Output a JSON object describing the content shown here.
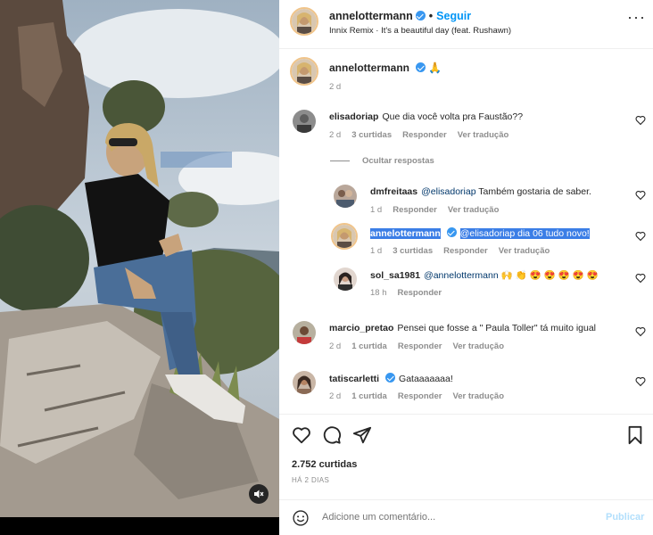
{
  "header": {
    "username": "annelottermann",
    "separator": "•",
    "follow_label": "Seguir",
    "song": "Innix Remix · It's a beautiful day (feat. Rushawn)",
    "more_label": "···"
  },
  "caption": {
    "username": "annelottermann",
    "emoji": "🙏",
    "time": "2 d"
  },
  "comments": [
    {
      "username": "elisadoriap",
      "text": "Que dia você volta pra Faustão??",
      "time": "2 d",
      "likes": "3 curtidas",
      "reply": "Responder",
      "translate": "Ver tradução",
      "hide_replies": "Ocultar respostas"
    }
  ],
  "replies": [
    {
      "username": "dmfreitaas",
      "mention": "@elisadoriap",
      "text": " Também gostaria de saber.",
      "time": "1 d",
      "reply": "Responder",
      "translate": "Ver tradução"
    },
    {
      "username": "annelottermann",
      "mention": "@elisadoriap",
      "text": " dia 06 tudo novo!",
      "time": "1 d",
      "likes": "3 curtidas",
      "reply": "Responder",
      "translate": "Ver tradução"
    },
    {
      "username": "sol_sa1981",
      "mention": "@annelottermann",
      "text": " 🙌 👏 😍 😍 😍 😍 😍",
      "time": "18 h",
      "reply": "Responder"
    }
  ],
  "more_comments": [
    {
      "username": "marcio_pretao",
      "text": "Pensei que fosse a \" Paula Toller\" tá muito igual",
      "time": "2 d",
      "likes": "1 curtida",
      "reply": "Responder",
      "translate": "Ver tradução"
    },
    {
      "username": "tatiscarletti",
      "text": "Gataaaaaaa!",
      "time": "2 d",
      "likes": "1 curtida",
      "reply": "Responder",
      "translate": "Ver tradução"
    }
  ],
  "stats": {
    "likes": "2.752 curtidas",
    "posted": "HÁ 2 DIAS"
  },
  "add_comment": {
    "placeholder": "Adicione um comentário...",
    "publish": "Publicar"
  },
  "colors": {
    "accent": "#0095f6",
    "verified": "#3897f0",
    "highlight": "#3b7ee6",
    "muted": "#8e8e8e"
  },
  "icons": [
    "heart-icon",
    "comment-icon",
    "share-icon",
    "bookmark-icon",
    "emoji-icon",
    "mute-icon",
    "verified-icon",
    "more-icon"
  ]
}
